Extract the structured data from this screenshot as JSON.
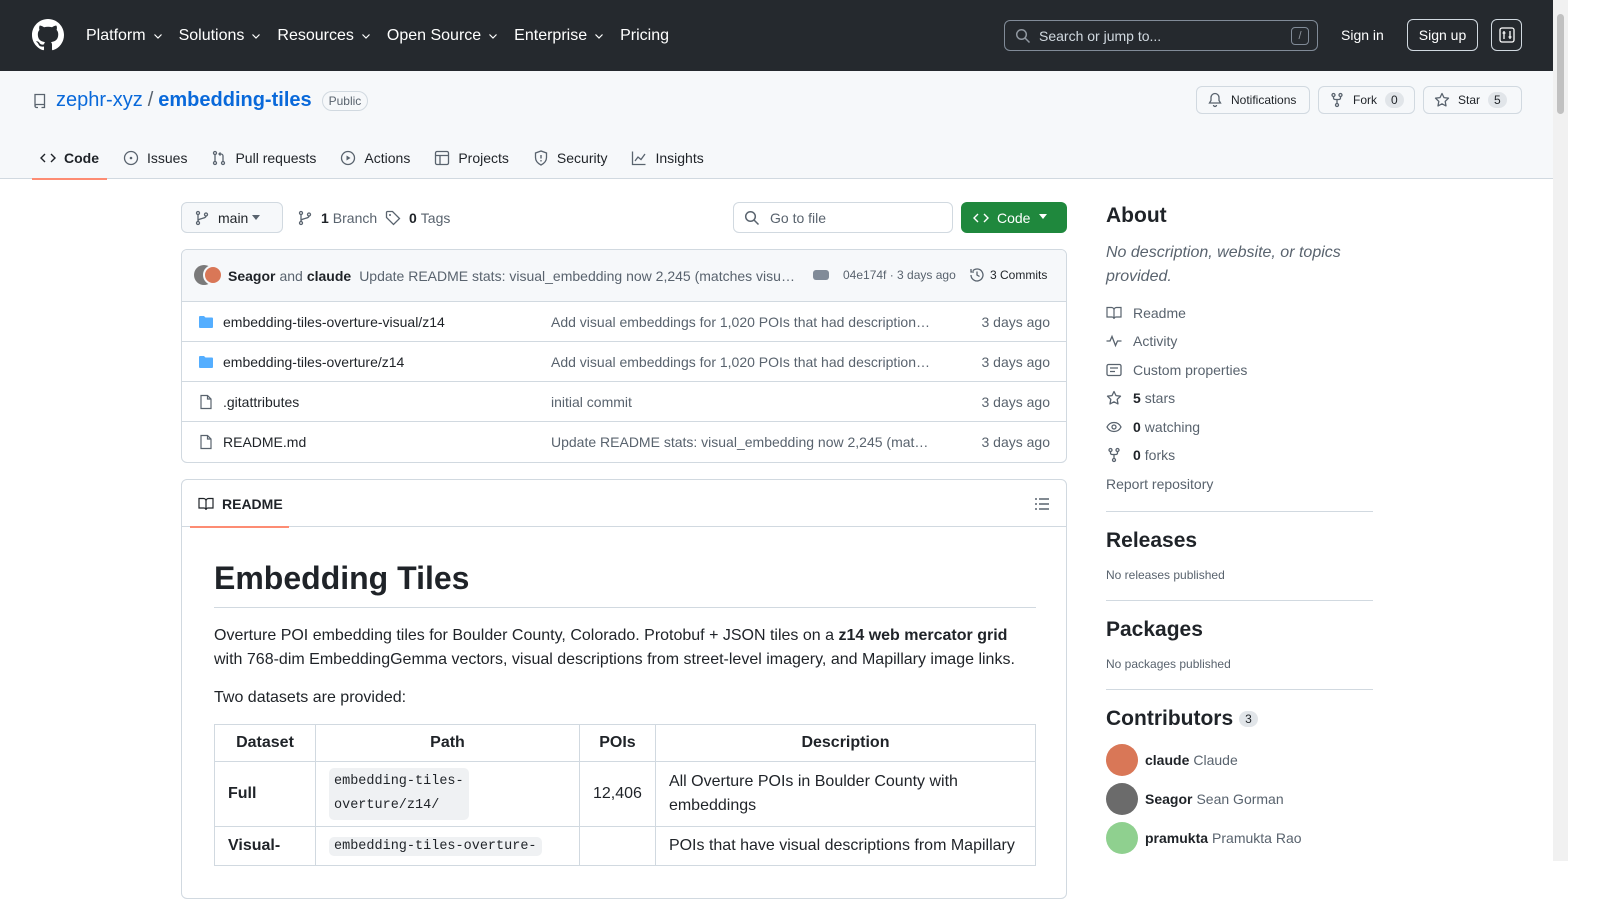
{
  "header": {
    "nav": [
      "Platform",
      "Solutions",
      "Resources",
      "Open Source",
      "Enterprise",
      "Pricing"
    ],
    "search_placeholder": "Search or jump to...",
    "search_kbd": "/",
    "sign_in": "Sign in",
    "sign_up": "Sign up"
  },
  "repo": {
    "owner": "zephr-xyz",
    "sep": "/",
    "name": "embedding-tiles",
    "visibility": "Public",
    "notifications": "Notifications",
    "fork_label": "Fork",
    "fork_count": "0",
    "star_label": "Star",
    "star_count": "5",
    "tabs": [
      "Code",
      "Issues",
      "Pull requests",
      "Actions",
      "Projects",
      "Security",
      "Insights"
    ]
  },
  "toolbar": {
    "branch": "main",
    "branch_count": "1",
    "branch_label": "Branch",
    "tag_count": "0",
    "tag_label": "Tags",
    "go_to_file": "Go to file",
    "code_button": "Code"
  },
  "latest_commit": {
    "author1": "Seagor",
    "and": "and",
    "author2": "claude",
    "message": "Update README stats: visual_embedding now 2,245 (matches visual_description)",
    "sha": "04e174f · 3 days ago",
    "commits": "3 Commits"
  },
  "files": [
    {
      "name": "embedding-tiles-overture-visual/z14",
      "type": "folder",
      "message": "Add visual embeddings for 1,020 POIs that had descriptions but no embedding",
      "date": "3 days ago"
    },
    {
      "name": "embedding-tiles-overture/z14",
      "type": "folder",
      "message": "Add visual embeddings for 1,020 POIs that had descriptions but no embedding",
      "date": "3 days ago"
    },
    {
      "name": ".gitattributes",
      "type": "file",
      "message": "initial commit",
      "date": "3 days ago"
    },
    {
      "name": "README.md",
      "type": "file",
      "message": "Update README stats: visual_embedding now 2,245 (matches visual_description)",
      "date": "3 days ago"
    }
  ],
  "readme": {
    "tab": "README",
    "title": "Embedding Tiles",
    "p1_before": "Overture POI embedding tiles for Boulder County, Colorado. Protobuf + JSON tiles on a ",
    "p1_bold": "z14 web mercator grid",
    "p1_after": " with 768-dim EmbeddingGemma vectors, visual descriptions from street-level imagery, and Mapillary image links.",
    "p2": "Two datasets are provided:",
    "table": {
      "headers": [
        "Dataset",
        "Path",
        "POIs",
        "Description"
      ],
      "rows": [
        {
          "dataset": "Full",
          "path": "embedding-tiles-overture/z14/",
          "pois": "12,406",
          "description": "All Overture POIs in Boulder County with embeddings"
        },
        {
          "dataset": "Visual-",
          "path": "embedding-tiles-overture-",
          "pois": "",
          "description": "POIs that have visual descriptions from Mapillary"
        }
      ]
    }
  },
  "sidebar": {
    "about": "About",
    "description": "No description, website, or topics provided.",
    "links": [
      "Readme",
      "Activity",
      "Custom properties"
    ],
    "stars_count": "5",
    "stars_label": "stars",
    "watching_count": "0",
    "watching_label": "watching",
    "forks_count": "0",
    "forks_label": "forks",
    "report": "Report repository",
    "releases": "Releases",
    "releases_none": "No releases published",
    "packages": "Packages",
    "packages_none": "No packages published",
    "contributors": "Contributors",
    "contributors_count": "3",
    "contributor_list": [
      {
        "login": "claude",
        "name": "Claude"
      },
      {
        "login": "Seagor",
        "name": "Sean Gorman"
      },
      {
        "login": "pramukta",
        "name": "Pramukta Rao"
      }
    ]
  }
}
